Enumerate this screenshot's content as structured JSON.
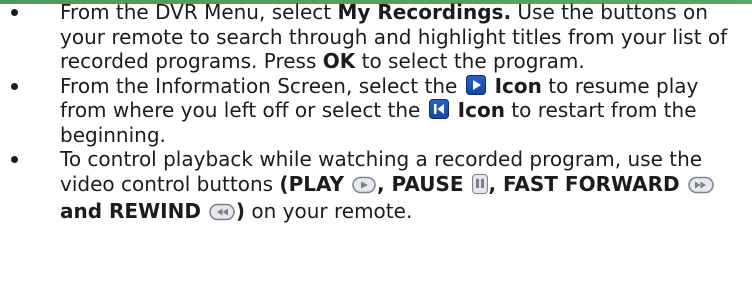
{
  "steps": [
    {
      "segments": [
        {
          "text": "From the DVR Menu, select ",
          "bold": false
        },
        {
          "text": "My Recordings.",
          "bold": true
        },
        {
          "text": "  Use the buttons on your remote to search through and highlight titles from your list of recorded programs.  Press ",
          "bold": false
        },
        {
          "text": "OK",
          "bold": true
        },
        {
          "text": " to select the program.",
          "bold": false
        }
      ]
    },
    {
      "segments": [
        {
          "text": "From the Information Screen, select the ",
          "bold": false
        },
        {
          "icon": "resume-play-icon"
        },
        {
          "text": " Icon",
          "bold": true
        },
        {
          "text": " to resume play from where you left off or select the ",
          "bold": false
        },
        {
          "icon": "restart-icon"
        },
        {
          "text": " Icon",
          "bold": true
        },
        {
          "text": " to restart from the beginning.",
          "bold": false
        }
      ]
    },
    {
      "segments": [
        {
          "text": "To control playback while watching a recorded program, use the video control buttons ",
          "bold": false
        },
        {
          "text": "(PLAY ",
          "bold": true
        },
        {
          "icon": "play-button-icon"
        },
        {
          "text": ", PAUSE ",
          "bold": true
        },
        {
          "icon": "pause-button-icon"
        },
        {
          "text": ", FAST FORWARD ",
          "bold": true
        },
        {
          "icon": "fast-forward-button-icon"
        },
        {
          "text": " and REWIND ",
          "bold": true
        },
        {
          "icon": "rewind-button-icon"
        },
        {
          "text": ")",
          "bold": true
        },
        {
          "text": " on your remote.",
          "bold": false
        }
      ]
    }
  ],
  "colors": {
    "text": "#1c1c1c",
    "icon_blue": "#1745a3",
    "control_gray": "#7d8290",
    "control_fill": "#e6e8ee"
  }
}
